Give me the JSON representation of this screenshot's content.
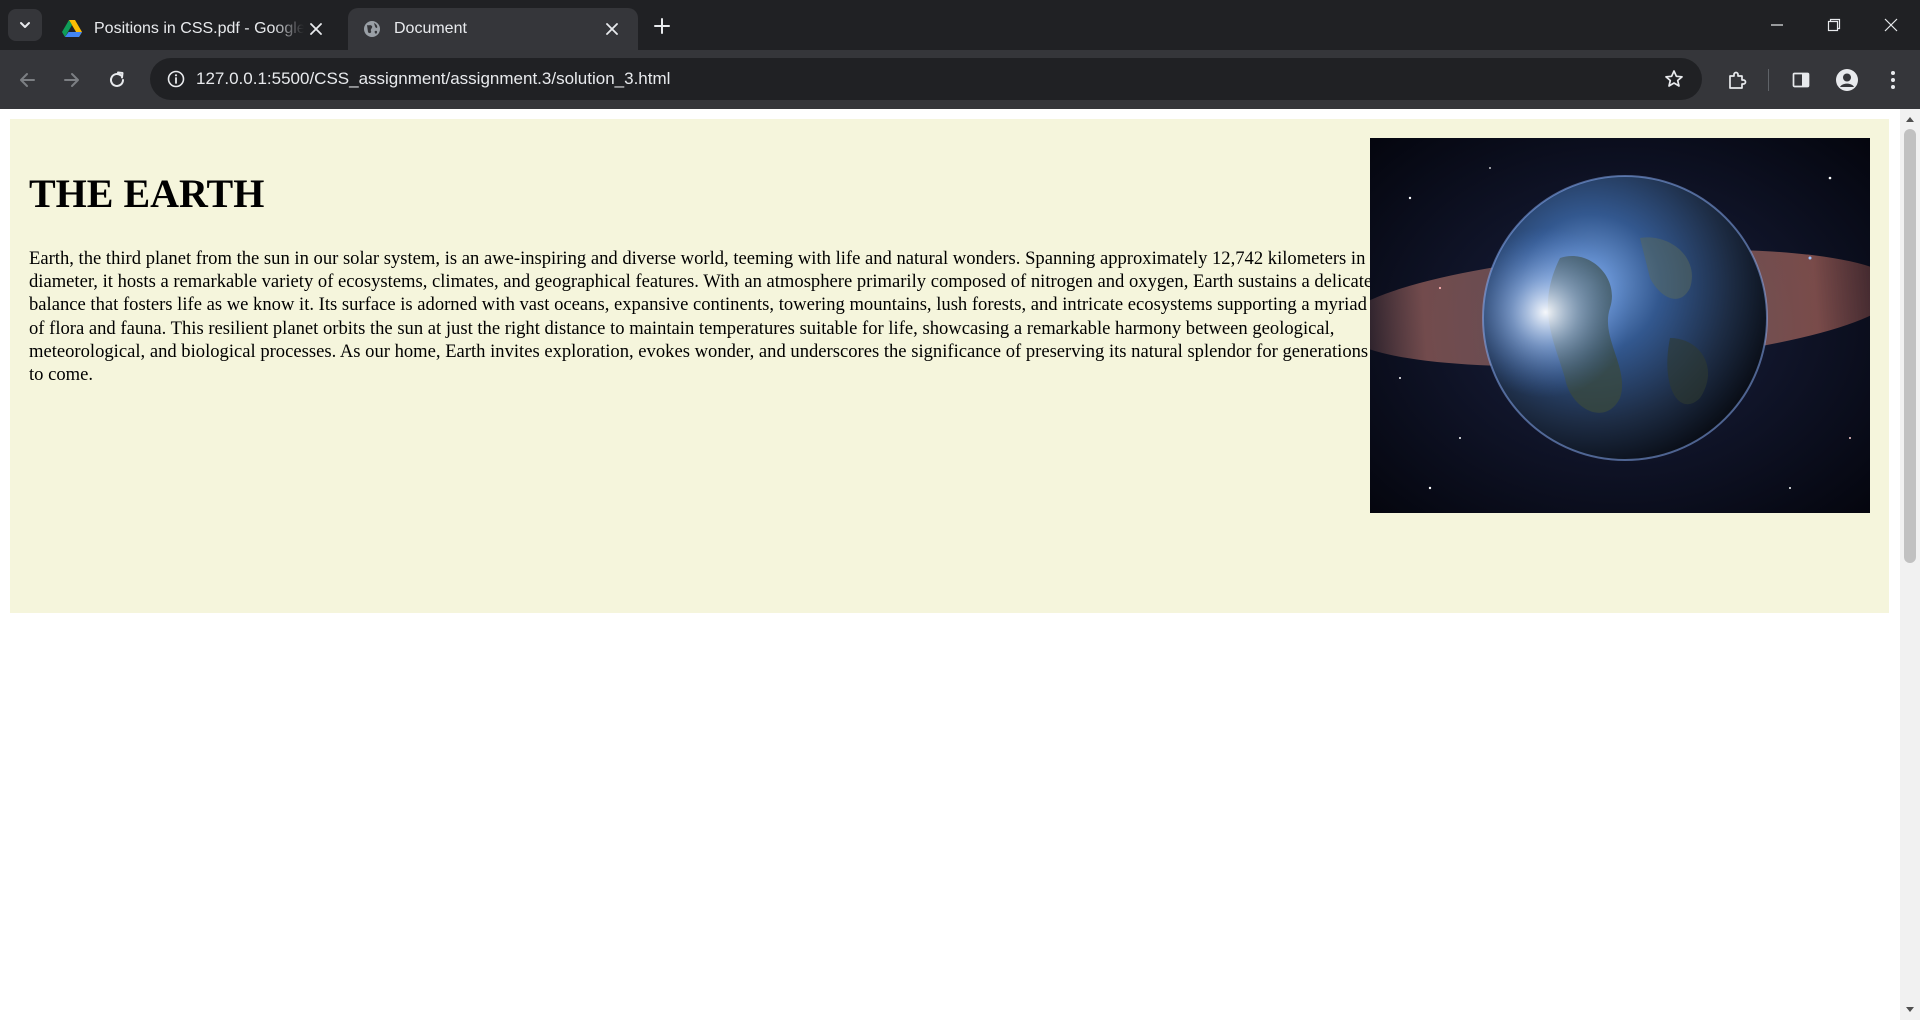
{
  "browser": {
    "tabs": [
      {
        "title": "Positions in CSS.pdf - Google Drive",
        "icon": "google-drive-icon",
        "active": false
      },
      {
        "title": "Document",
        "icon": "globe-icon",
        "active": true
      }
    ],
    "url": "127.0.0.1:5500/CSS_assignment/assignment.3/solution_3.html",
    "colors": {
      "tabstrip": "#202124",
      "toolbar": "#35363a",
      "omnibox": "#202124",
      "text": "#e8eaed"
    }
  },
  "page": {
    "background": "#f5f5dc",
    "heading": "THE EARTH",
    "paragraph": "Earth, the third planet from the sun in our solar system, is an awe-inspiring and diverse world, teeming with life and natural wonders. Spanning approximately 12,742 kilometers in diameter, it hosts a remarkable variety of ecosystems, climates, and geographical features. With an atmosphere primarily composed of nitrogen and oxygen, Earth sustains a delicate balance that fosters life as we know it. Its surface is adorned with vast oceans, expansive continents, towering mountains, lush forests, and intricate ecosystems supporting a myriad of flora and fauna. This resilient planet orbits the sun at just the right distance to maintain temperatures suitable for life, showcasing a remarkable harmony between geological, meteorological, and biological processes. As our home, Earth invites exploration, evokes wonder, and underscores the significance of preserving its natural splendor for generations to come.",
    "image": "earth-in-space-image"
  }
}
